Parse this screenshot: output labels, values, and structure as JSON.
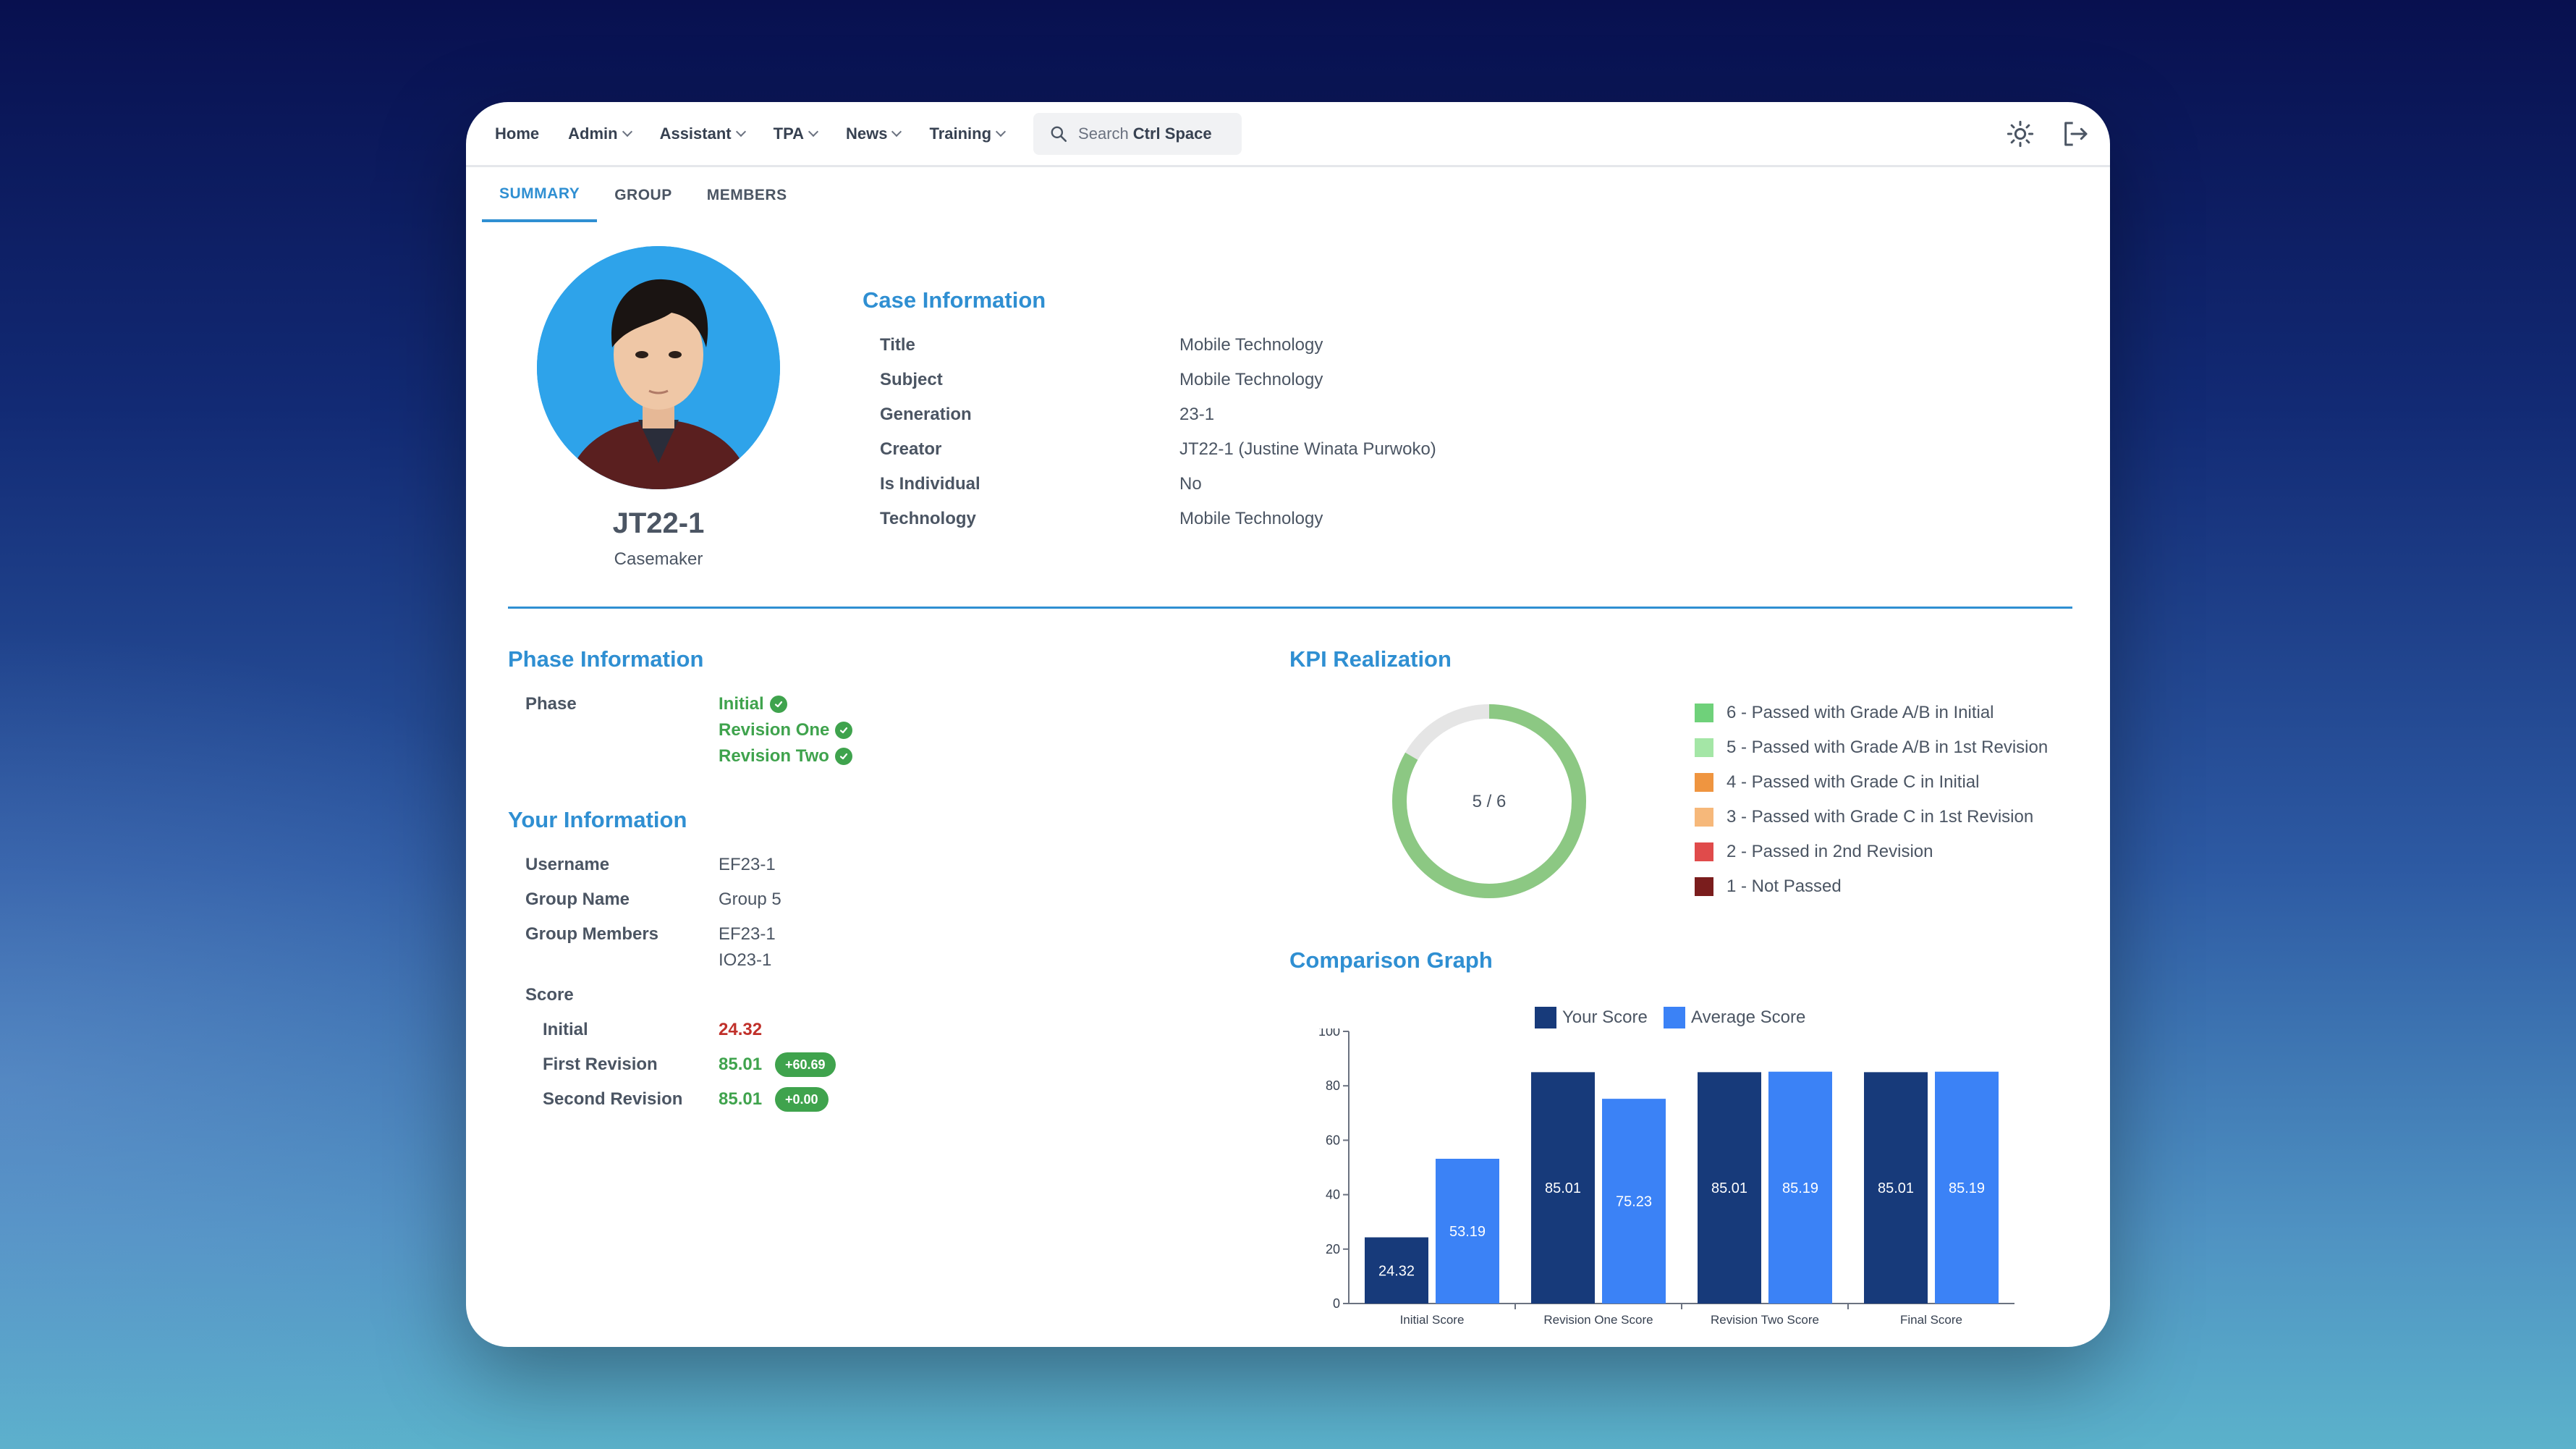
{
  "nav": {
    "items": [
      {
        "label": "Home",
        "dropdown": false
      },
      {
        "label": "Admin",
        "dropdown": true
      },
      {
        "label": "Assistant",
        "dropdown": true
      },
      {
        "label": "TPA",
        "dropdown": true
      },
      {
        "label": "News",
        "dropdown": true
      },
      {
        "label": "Training",
        "dropdown": true
      }
    ],
    "search": {
      "prefix": "Search",
      "shortcut": "Ctrl Space",
      "icon": "search-icon"
    },
    "right_icons": [
      "sun-icon",
      "logout-icon"
    ]
  },
  "tabs": [
    {
      "label": "SUMMARY",
      "active": true
    },
    {
      "label": "GROUP",
      "active": false
    },
    {
      "label": "MEMBERS",
      "active": false
    }
  ],
  "profile": {
    "name": "JT22-1",
    "role": "Casemaker"
  },
  "case_information": {
    "title": "Case Information",
    "rows": [
      {
        "label": "Title",
        "value": "Mobile Technology"
      },
      {
        "label": "Subject",
        "value": "Mobile Technology"
      },
      {
        "label": "Generation",
        "value": "23-1"
      },
      {
        "label": "Creator",
        "value": "JT22-1 (Justine Winata Purwoko)"
      },
      {
        "label": "Is Individual",
        "value": "No"
      },
      {
        "label": "Technology",
        "value": "Mobile Technology"
      }
    ]
  },
  "phase_information": {
    "title": "Phase Information",
    "label": "Phase",
    "phases": [
      "Initial",
      "Revision One",
      "Revision Two"
    ]
  },
  "your_information": {
    "title": "Your Information",
    "username_label": "Username",
    "username": "EF23-1",
    "group_name_label": "Group Name",
    "group_name": "Group 5",
    "group_members_label": "Group Members",
    "group_members": [
      "EF23-1",
      "IO23-1"
    ],
    "score_label": "Score",
    "scores": [
      {
        "label": "Initial",
        "value": "24.32",
        "status": "fail",
        "delta": ""
      },
      {
        "label": "First Revision",
        "value": "85.01",
        "status": "pass",
        "delta": "+60.69"
      },
      {
        "label": "Second Revision",
        "value": "85.01",
        "status": "pass",
        "delta": "+0.00"
      }
    ]
  },
  "kpi": {
    "title": "KPI Realization",
    "center_text": "5 / 6",
    "fraction": 0.8333,
    "ring_color": "#8cc883",
    "track_color": "#e5e5e5",
    "legend": [
      {
        "label": "6 - Passed with Grade A/B in Initial",
        "color": "#6fd17a"
      },
      {
        "label": "5 - Passed with Grade A/B in 1st Revision",
        "color": "#a4e6a6"
      },
      {
        "label": "4 - Passed with Grade C in Initial",
        "color": "#ef9540"
      },
      {
        "label": "3 - Passed with Grade C in 1st Revision",
        "color": "#f6b87a"
      },
      {
        "label": "2 - Passed in 2nd Revision",
        "color": "#e04b4b"
      },
      {
        "label": "1 - Not Passed",
        "color": "#7a1d1d"
      }
    ]
  },
  "comparison": {
    "title": "Comparison Graph"
  },
  "chart_data": {
    "type": "bar",
    "categories": [
      "Initial Score",
      "Revision One Score",
      "Revision Two Score",
      "Final Score"
    ],
    "series": [
      {
        "name": "Your Score",
        "values": [
          24.32,
          85.01,
          85.01,
          85.01
        ],
        "color": "#173a7a"
      },
      {
        "name": "Average Score",
        "values": [
          53.19,
          75.23,
          85.19,
          85.19
        ],
        "color": "#3b82f6"
      }
    ],
    "yticks": [
      "0",
      "20",
      "40",
      "60",
      "80",
      "100"
    ],
    "ylim": [
      0,
      100
    ],
    "legend_position": "top-center",
    "data_labels": true
  }
}
